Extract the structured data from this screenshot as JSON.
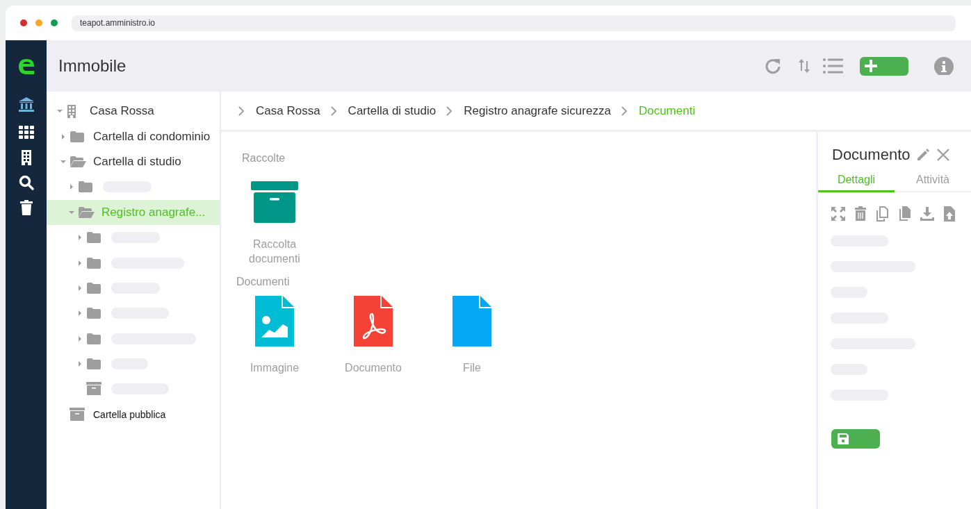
{
  "browser": {
    "address": "teapot.amministro.io"
  },
  "sidebar": {
    "items": [
      {
        "kind": "bank",
        "selected": true
      },
      {
        "kind": "grid",
        "selected": false
      },
      {
        "kind": "building",
        "selected": false
      },
      {
        "kind": "search",
        "selected": false
      },
      {
        "kind": "trash",
        "selected": false
      }
    ]
  },
  "header": {
    "title": "Immobile",
    "tools": [
      {
        "kind": "refresh"
      },
      {
        "kind": "sort"
      },
      {
        "kind": "list"
      },
      {
        "kind": "add"
      },
      {
        "kind": "info"
      }
    ]
  },
  "tree": [
    {
      "kind": "building",
      "label": "Casa Rossa",
      "expanded": true,
      "selected": false,
      "children": [
        {
          "kind": "folder",
          "label": "Cartella di condominio",
          "expanded": false,
          "selected": false
        },
        {
          "kind": "folder",
          "label": "Cartella di studio",
          "expanded": true,
          "selected": false,
          "children": [
            {
              "kind": "folder",
              "expanded": false,
              "selected": false
            },
            {
              "kind": "folder",
              "label": "Registro anagrafe...",
              "expanded": true,
              "selected": true,
              "children": [
                {
                  "kind": "folder",
                  "expanded": false,
                  "selected": false
                },
                {
                  "kind": "folder",
                  "expanded": false,
                  "selected": false
                },
                {
                  "kind": "folder",
                  "expanded": false,
                  "selected": false
                },
                {
                  "kind": "folder",
                  "expanded": false,
                  "selected": false
                },
                {
                  "kind": "folder",
                  "expanded": false,
                  "selected": false
                },
                {
                  "kind": "folder",
                  "expanded": false,
                  "selected": false
                },
                {
                  "kind": "archive",
                  "selected": false
                }
              ]
            }
          ]
        },
        {
          "kind": "archive",
          "label": "Cartella pubblica",
          "selected": false
        }
      ]
    }
  ],
  "breadcrumb": [
    {
      "label": "Casa Rossa",
      "selected": false
    },
    {
      "label": "Cartella di studio",
      "selected": false
    },
    {
      "label": "Registro anagrafe sicurezza",
      "selected": false
    },
    {
      "label": "Documenti",
      "selected": true
    }
  ],
  "sections": [
    {
      "title": "Raccolte",
      "items": [
        {
          "kind": "archive",
          "label": "Raccolta documenti"
        }
      ]
    },
    {
      "title": "Documenti",
      "items": [
        {
          "kind": "image",
          "label": "Immagine"
        },
        {
          "kind": "pdf",
          "label": "Documento"
        },
        {
          "kind": "file",
          "label": "File"
        }
      ]
    }
  ],
  "panel": {
    "title": "Documento",
    "tabs": [
      {
        "label": "Dettagli",
        "selected": true
      },
      {
        "label": "Attività",
        "selected": false
      }
    ],
    "actions": [
      {
        "kind": "expand"
      },
      {
        "kind": "delete"
      },
      {
        "kind": "copy"
      },
      {
        "kind": "duplicate"
      },
      {
        "kind": "download"
      },
      {
        "kind": "upload"
      }
    ]
  }
}
